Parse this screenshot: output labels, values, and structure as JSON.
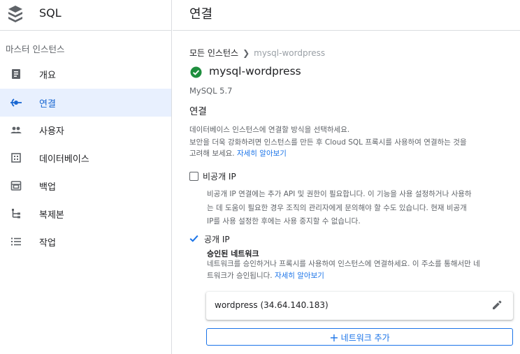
{
  "app": {
    "title": "SQL"
  },
  "sidebar": {
    "section_label": "마스터 인스턴스",
    "items": [
      {
        "label": "개요",
        "icon": "overview-icon",
        "active": false
      },
      {
        "label": "연결",
        "icon": "connections-icon",
        "active": true
      },
      {
        "label": "사용자",
        "icon": "users-icon",
        "active": false
      },
      {
        "label": "데이터베이스",
        "icon": "databases-icon",
        "active": false
      },
      {
        "label": "백업",
        "icon": "backups-icon",
        "active": false
      },
      {
        "label": "복제본",
        "icon": "replicas-icon",
        "active": false
      },
      {
        "label": "작업",
        "icon": "operations-icon",
        "active": false
      }
    ]
  },
  "header": {
    "title": "연결"
  },
  "breadcrumb": {
    "parent": "모든 인스턴스",
    "current": "mysql-wordpress"
  },
  "instance": {
    "name": "mysql-wordpress",
    "status": "running",
    "version": "MySQL 5.7"
  },
  "connectivity": {
    "title": "연결",
    "intro": "데이터베이스 인스턴스에 연결할 방식을 선택하세요.",
    "security_line1": "보안을 더욱 강화하려면 인스턴스를 만든 후 Cloud SQL 프록시를 사용하여 연결하는 것을",
    "security_line2_prefix": "고려해 보세요. ",
    "learn_more": "자세히 알아보기",
    "private_ip": {
      "label": "비공개 IP",
      "checked": false,
      "desc_line1": "비공개 IP 연결에는 추가 API 및 권한이 필요합니다. 이 기능을 사용 설정하거나 사용하",
      "desc_line2": "는 데 도움이 필요한 경우 조직의 관리자에게 문의해야 할 수도 있습니다. 현재 비공개",
      "desc_line3": "IP를 사용 설정한 후에는 사용 중지할 수 없습니다."
    },
    "public_ip": {
      "label": "공개 IP",
      "checked": true,
      "authorized_networks_title": "승인된 네트워크",
      "desc_line1": "네트워크를 승인하거나 프록시를 사용하여 인스턴스에 연결하세요. 이 주소를 통해서만 네",
      "desc_line2_prefix": "트워크가 승인됩니다. ",
      "learn_more": "자세히 알아보기",
      "networks": [
        {
          "display": "wordpress (34.64.140.183)"
        }
      ],
      "add_network_label": "네트워크 추가"
    }
  },
  "colors": {
    "accent": "#1a73e8",
    "active_bg": "#e8f0fe",
    "success": "#1e8e3e",
    "divider": "#dadce0"
  }
}
